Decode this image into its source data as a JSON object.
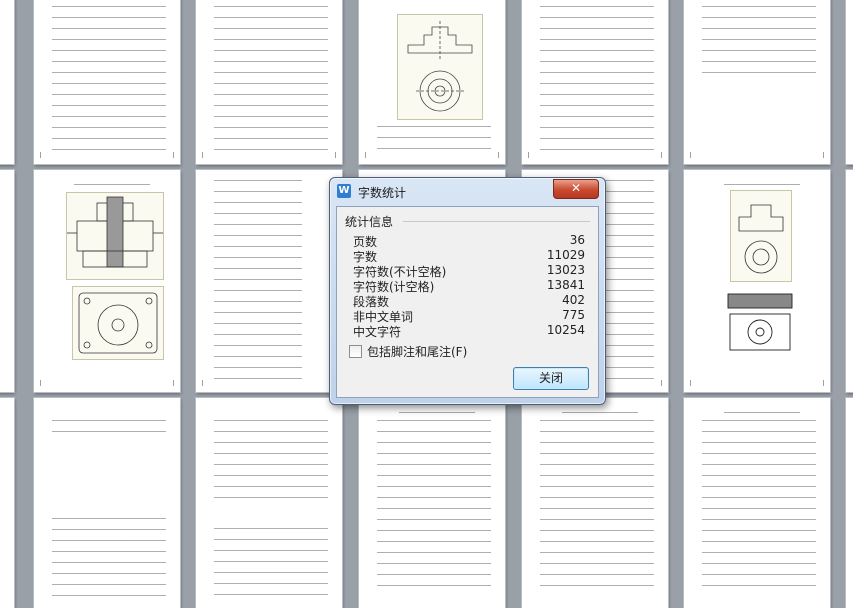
{
  "dialog": {
    "title": "字数统计",
    "app_icon": "W",
    "close_glyph": "✕",
    "group_label": "统计信息",
    "stats": [
      {
        "label": "页数",
        "value": "36"
      },
      {
        "label": "字数",
        "value": "11029"
      },
      {
        "label": "字符数(不计空格)",
        "value": "13023"
      },
      {
        "label": "字符数(计空格)",
        "value": "13841"
      },
      {
        "label": "段落数",
        "value": "402"
      },
      {
        "label": "非中文单词",
        "value": "775"
      },
      {
        "label": "中文字符",
        "value": "10254"
      }
    ],
    "include_footnotes_label": "包括脚注和尾注(F)",
    "include_footnotes_checked": false,
    "close_button_label": "关闭"
  },
  "colors": {
    "accent_icon": "#2e7fd2",
    "close_button": "#c84a2f",
    "background": "#9aa0a8"
  }
}
